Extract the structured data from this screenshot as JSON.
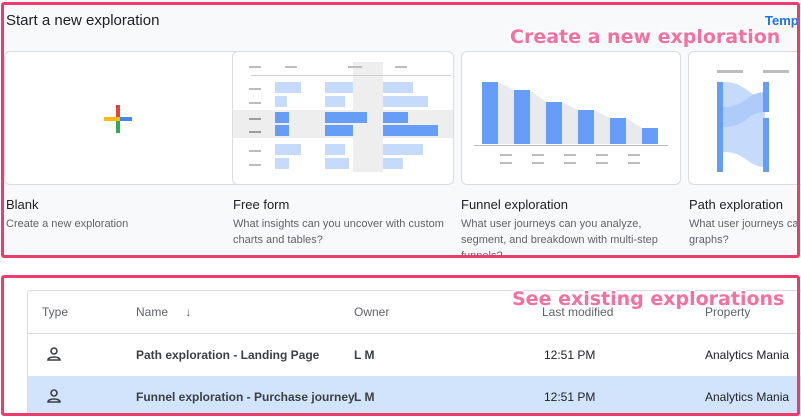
{
  "header": {
    "title": "Start a new exploration",
    "templates_link": "Temp"
  },
  "annotations": {
    "create": "Create a new exploration",
    "existing": "See existing explorations"
  },
  "cards": [
    {
      "title": "Blank",
      "desc": "Create a new exploration"
    },
    {
      "title": "Free form",
      "desc": "What insights can you uncover with custom charts and tables?"
    },
    {
      "title": "Funnel exploration",
      "desc": "What user journeys can you analyze, segment, and breakdown with multi-step funnels?"
    },
    {
      "title": "Path exploration",
      "desc": "What user journeys ca graphs?"
    }
  ],
  "table": {
    "headers": {
      "type": "Type",
      "name": "Name",
      "sort": "↓",
      "owner": "Owner",
      "modified": "Last modified",
      "property": "Property"
    },
    "rows": [
      {
        "name": "Path exploration - Landing Page",
        "owner": "L M",
        "modified": "12:51 PM",
        "property": "Analytics Mania"
      },
      {
        "name": "Funnel exploration - Purchase journey",
        "owner": "L M",
        "modified": "12:51 PM",
        "property": "Analytics Mania"
      }
    ]
  },
  "colors": {
    "accent": "#1a73e8",
    "highlight_border": "#ee3b6e",
    "callout": "#f5709f",
    "selected_row": "#d2e3fc"
  }
}
